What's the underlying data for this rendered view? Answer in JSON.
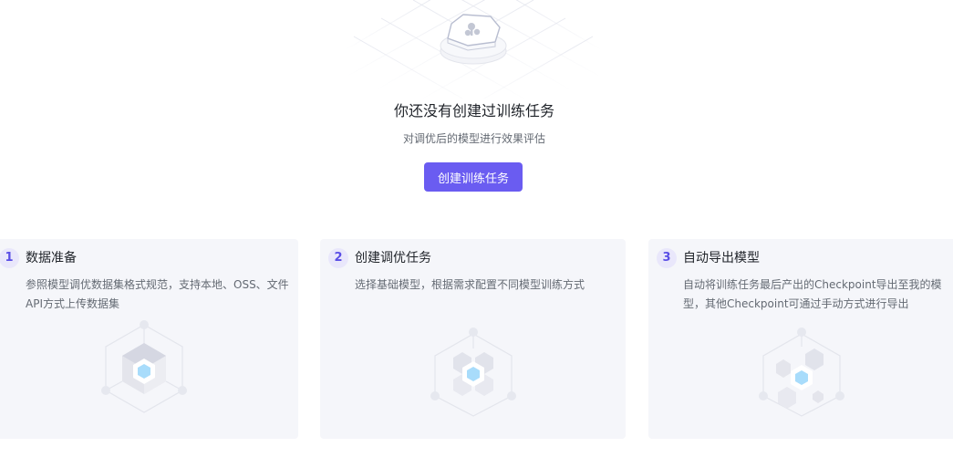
{
  "empty_state": {
    "title": "你还没有创建过训练任务",
    "subtitle": "对调优后的模型进行效果评估",
    "create_button": "创建训练任务"
  },
  "steps": [
    {
      "number": "1",
      "title": "数据准备",
      "description": "参照模型调优数据集格式规范，支持本地、OSS、文件API方式上传数据集"
    },
    {
      "number": "2",
      "title": "创建调优任务",
      "description": "选择基础模型，根据需求配置不同模型训练方式"
    },
    {
      "number": "3",
      "title": "自动导出模型",
      "description": "自动将训练任务最后产出的Checkpoint导出至我的模型，其他Checkpoint可通过手动方式进行导出"
    }
  ],
  "colors": {
    "accent": "#6a5cf1",
    "card_bg": "#f5f6fa",
    "step_badge_bg": "#e9e7fb",
    "cube_highlight": "#a8dcfb"
  }
}
